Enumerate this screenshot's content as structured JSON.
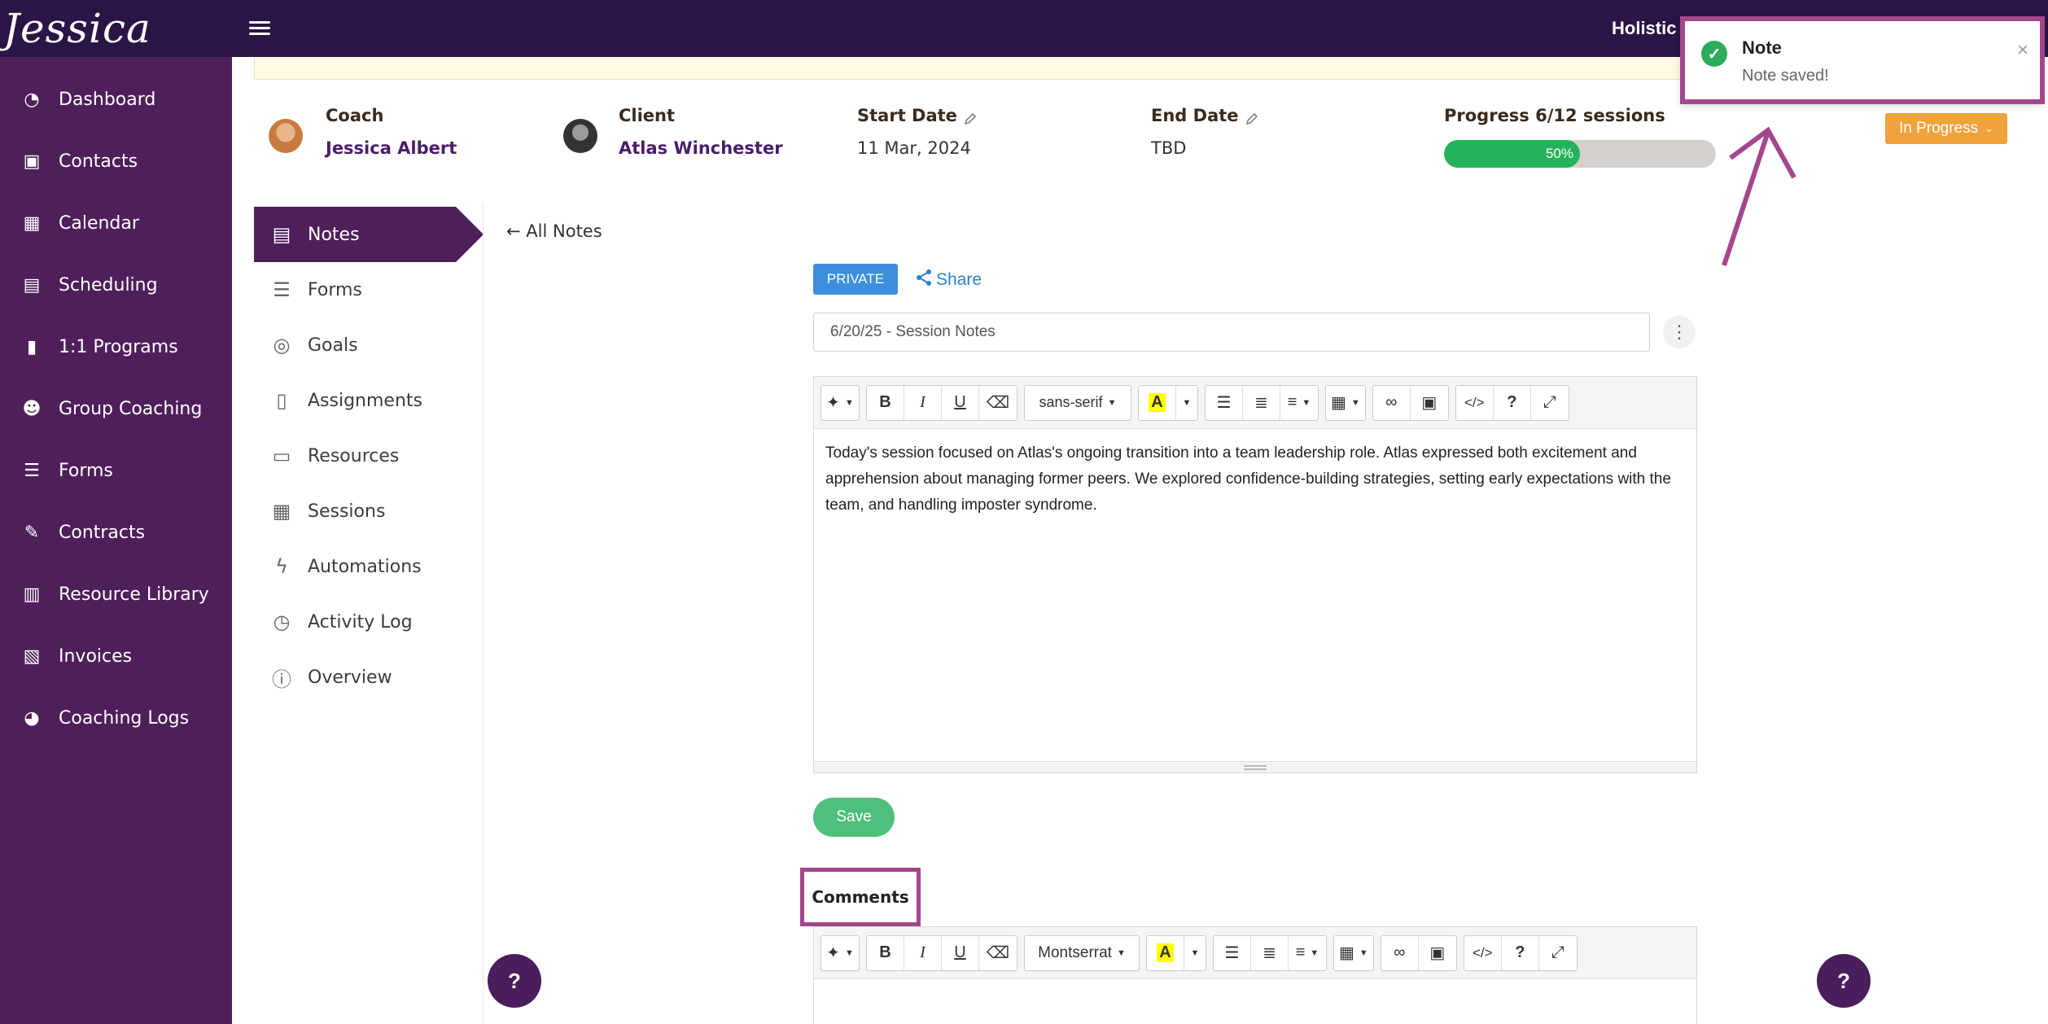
{
  "topbar": {
    "logo_text": "Jessica Albert",
    "brand": "Holistic"
  },
  "sidebar": {
    "items": [
      {
        "label": "Dashboard",
        "icon": "dashboard-icon"
      },
      {
        "label": "Contacts",
        "icon": "contacts-icon"
      },
      {
        "label": "Calendar",
        "icon": "calendar-icon"
      },
      {
        "label": "Scheduling",
        "icon": "scheduling-icon"
      },
      {
        "label": "1:1 Programs",
        "icon": "book-icon"
      },
      {
        "label": "Group Coaching",
        "icon": "group-icon"
      },
      {
        "label": "Forms",
        "icon": "forms-icon"
      },
      {
        "label": "Contracts",
        "icon": "contract-icon"
      },
      {
        "label": "Resource Library",
        "icon": "library-icon"
      },
      {
        "label": "Invoices",
        "icon": "invoice-icon"
      },
      {
        "label": "Coaching Logs",
        "icon": "clock-icon"
      }
    ]
  },
  "program": {
    "coach_label": "Coach",
    "coach_name": "Jessica Albert",
    "client_label": "Client",
    "client_name": "Atlas Winchester",
    "start_label": "Start Date",
    "start_value": "11 Mar, 2024",
    "end_label": "End Date",
    "end_value": "TBD",
    "progress_label": "Progress 6/12 sessions",
    "progress_text": "50%",
    "progress_fraction": 0.5,
    "status": "In Progress"
  },
  "subnav": {
    "items": [
      {
        "label": "Notes"
      },
      {
        "label": "Forms"
      },
      {
        "label": "Goals"
      },
      {
        "label": "Assignments"
      },
      {
        "label": "Resources"
      },
      {
        "label": "Sessions"
      },
      {
        "label": "Automations"
      },
      {
        "label": "Activity Log"
      },
      {
        "label": "Overview"
      }
    ]
  },
  "note": {
    "back_label": "All Notes",
    "private_label": "PRIVATE",
    "share_label": "Share",
    "title_value": "6/20/25 - Session Notes",
    "font_label": "sans-serif",
    "body": "Today's session focused on Atlas's ongoing transition into a team leadership role. Atlas expressed both excitement and apprehension about managing former peers. We explored confidence-building strategies, setting early expectations with the team, and handling imposter syndrome.",
    "save_label": "Save"
  },
  "comments": {
    "heading": "Comments",
    "font_label": "Montserrat"
  },
  "help": {
    "label": "?"
  },
  "toast": {
    "title": "Note",
    "message": "Note saved!"
  },
  "colors": {
    "primary": "#4f1f5b",
    "topbar": "#2b1446",
    "success": "#24b35a",
    "status": "#f0a23b",
    "annotation": "#a3468e"
  }
}
